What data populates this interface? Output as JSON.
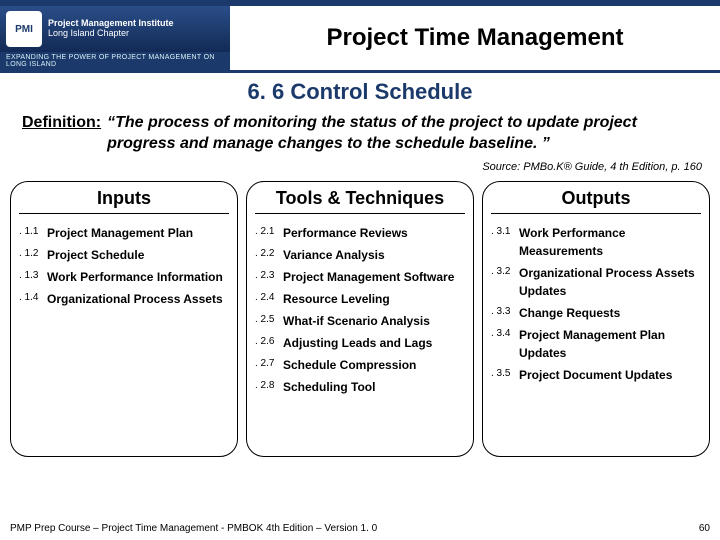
{
  "header": {
    "logo_badge": "PMI",
    "logo_line1": "Project Management Institute",
    "logo_line2": "Long Island Chapter",
    "tagline": "EXPANDING THE POWER OF PROJECT MANAGEMENT ON LONG ISLAND",
    "title": "Project Time Management"
  },
  "section_title": "6. 6 Control Schedule",
  "definition": {
    "label": "Definition:",
    "text": "“The process of monitoring the status of the project to update project progress and manage changes to the schedule baseline. ”"
  },
  "source": "Source: PMBo.K® Guide, 4 th Edition, p. 160",
  "panels": {
    "inputs": {
      "title": "Inputs",
      "items": [
        {
          "num": ". 1.1",
          "label": "Project Management Plan"
        },
        {
          "num": ". 1.2",
          "label": "Project Schedule"
        },
        {
          "num": ". 1.3",
          "label": "Work Performance Information"
        },
        {
          "num": ". 1.4",
          "label": "Organizational Process Assets"
        }
      ]
    },
    "tools": {
      "title": "Tools & Techniques",
      "items": [
        {
          "num": ". 2.1",
          "label": "Performance Reviews"
        },
        {
          "num": ". 2.2",
          "label": "Variance Analysis"
        },
        {
          "num": ". 2.3",
          "label": "Project Management Software"
        },
        {
          "num": ". 2.4",
          "label": "Resource Leveling"
        },
        {
          "num": ". 2.5",
          "label": "What-if Scenario Analysis"
        },
        {
          "num": ". 2.6",
          "label": "Adjusting Leads and Lags"
        },
        {
          "num": ". 2.7",
          "label": "Schedule Compression"
        },
        {
          "num": ". 2.8",
          "label": "Scheduling Tool"
        }
      ]
    },
    "outputs": {
      "title": "Outputs",
      "items": [
        {
          "num": ". 3.1",
          "label": "Work Performance Measurements"
        },
        {
          "num": ". 3.2",
          "label": "Organizational Process Assets Updates"
        },
        {
          "num": ". 3.3",
          "label": "Change Requests"
        },
        {
          "num": ". 3.4",
          "label": "Project Management Plan Updates"
        },
        {
          "num": ". 3.5",
          "label": "Project Document Updates"
        }
      ]
    }
  },
  "footer": {
    "left": "PMP Prep Course – Project Time Management - PMBOK 4th Edition – Version 1. 0",
    "page": "60"
  }
}
